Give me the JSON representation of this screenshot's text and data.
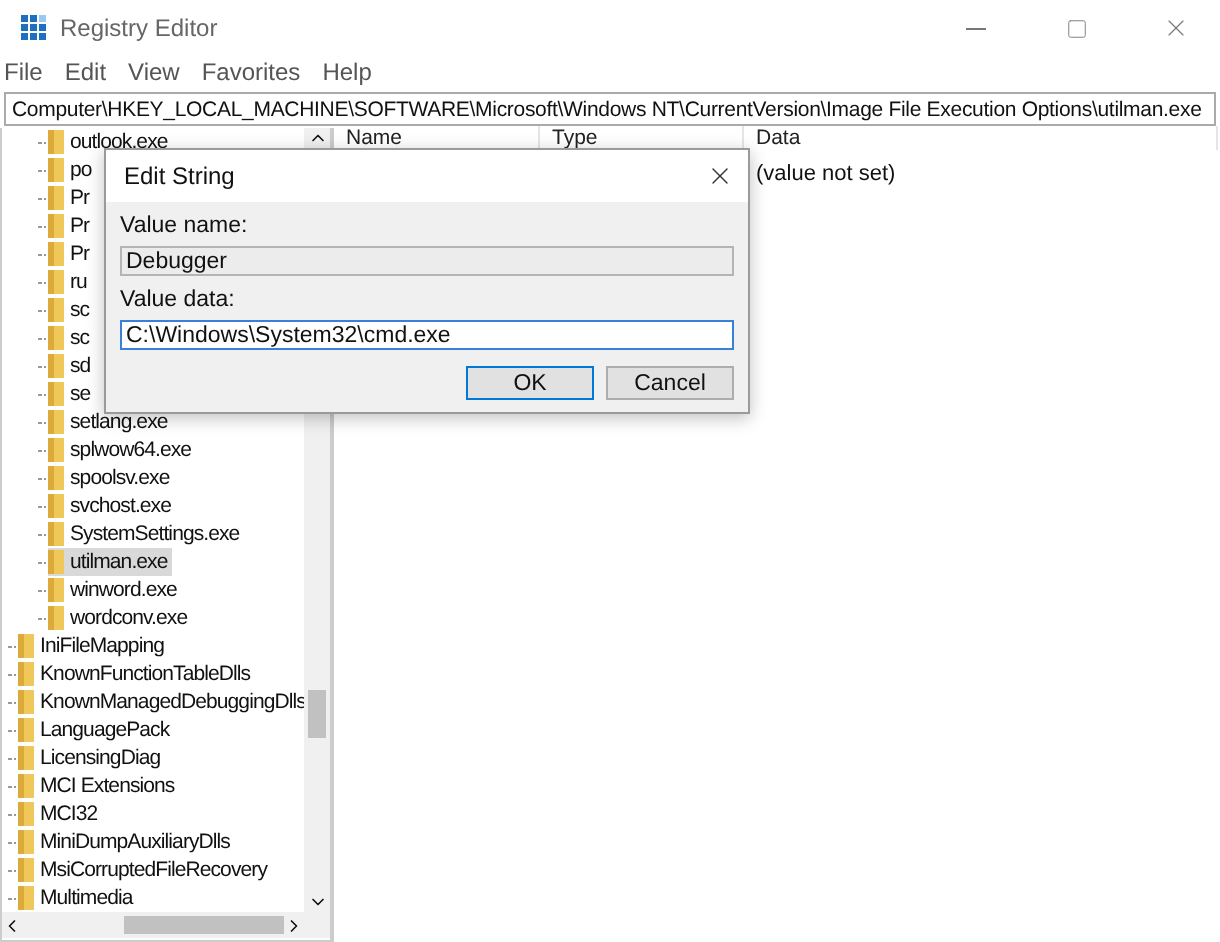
{
  "window": {
    "title": "Registry Editor"
  },
  "menu": [
    "File",
    "Edit",
    "View",
    "Favorites",
    "Help"
  ],
  "address": "Computer\\HKEY_LOCAL_MACHINE\\SOFTWARE\\Microsoft\\Windows NT\\CurrentVersion\\Image File Execution Options\\utilman.exe",
  "tree": {
    "continued_children": [
      {
        "label": "outlook.exe",
        "selected": false
      },
      {
        "label": "po",
        "selected": false
      },
      {
        "label": "Pr",
        "selected": false
      },
      {
        "label": "Pr",
        "selected": false
      },
      {
        "label": "Pr",
        "selected": false
      },
      {
        "label": "ru",
        "selected": false
      },
      {
        "label": "sc",
        "selected": false
      },
      {
        "label": "sc",
        "selected": false
      },
      {
        "label": "sd",
        "selected": false
      },
      {
        "label": "se",
        "selected": false
      },
      {
        "label": "setlang.exe",
        "selected": false
      },
      {
        "label": "splwow64.exe",
        "selected": false
      },
      {
        "label": "spoolsv.exe",
        "selected": false
      },
      {
        "label": "svchost.exe",
        "selected": false
      },
      {
        "label": "SystemSettings.exe",
        "selected": false
      },
      {
        "label": "utilman.exe",
        "selected": true
      },
      {
        "label": "winword.exe",
        "selected": false
      },
      {
        "label": "wordconv.exe",
        "selected": false
      }
    ],
    "items": [
      {
        "label": "IniFileMapping",
        "selected": false
      },
      {
        "label": "KnownFunctionTableDlls",
        "selected": false
      },
      {
        "label": "KnownManagedDebuggingDlls",
        "selected": false
      },
      {
        "label": "LanguagePack",
        "selected": false
      },
      {
        "label": "LicensingDiag",
        "selected": false
      },
      {
        "label": "MCI Extensions",
        "selected": false
      },
      {
        "label": "MCI32",
        "selected": false
      },
      {
        "label": "MiniDumpAuxiliaryDlls",
        "selected": false
      },
      {
        "label": "MsiCorruptedFileRecovery",
        "selected": false
      },
      {
        "label": "Multimedia",
        "selected": false
      }
    ]
  },
  "list": {
    "columns": [
      "Name",
      "Type",
      "Data"
    ],
    "rows": [
      {
        "data": "(value not set)"
      }
    ]
  },
  "dialog": {
    "title": "Edit String",
    "fields": [
      {
        "label": "Value name:",
        "value": "Debugger",
        "readonly": true
      },
      {
        "label": "Value data:",
        "value": "C:\\Windows\\System32\\cmd.exe",
        "readonly": false
      }
    ],
    "buttons": [
      {
        "label": "OK",
        "default": true
      },
      {
        "label": "Cancel",
        "default": false
      }
    ]
  }
}
